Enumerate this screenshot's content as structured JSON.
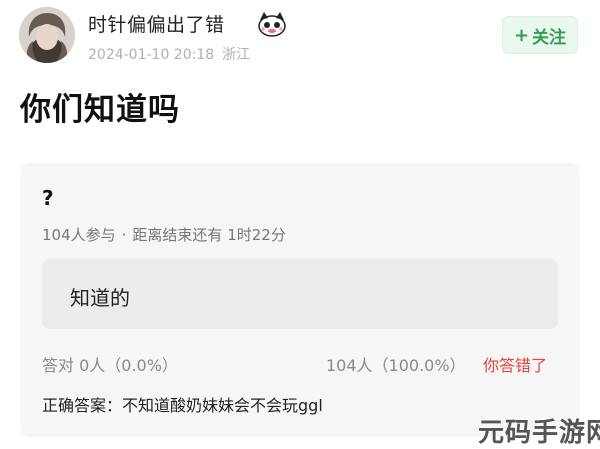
{
  "header": {
    "username": "时针偏偏出了错",
    "date": "2024-01-10 20:18",
    "location": "浙江",
    "follow_label": "关注",
    "follow_plus": "+"
  },
  "post": {
    "title": "你们知道吗"
  },
  "poll": {
    "question": "?",
    "participants": "104人参与",
    "separator": "·",
    "time_left": "距离结束还有 1时22分",
    "option_label": "知道的",
    "correct_stat": "答对  0人（0.0%）",
    "total_stat": "104人（100.0%）",
    "wrong_label": "你答错了",
    "answer_text": "正确答案：不知道酸奶妹妹会不会玩ggl"
  },
  "watermark": "元码手游网",
  "colors": {
    "accent_green": "#2fa04e",
    "follow_bg": "#eaf7ee",
    "error_red": "#e4463b",
    "card_bg": "#f6f6f6"
  },
  "icons": {
    "avatar": "user-avatar-photo",
    "badge": "cartoon-badge-icon"
  }
}
